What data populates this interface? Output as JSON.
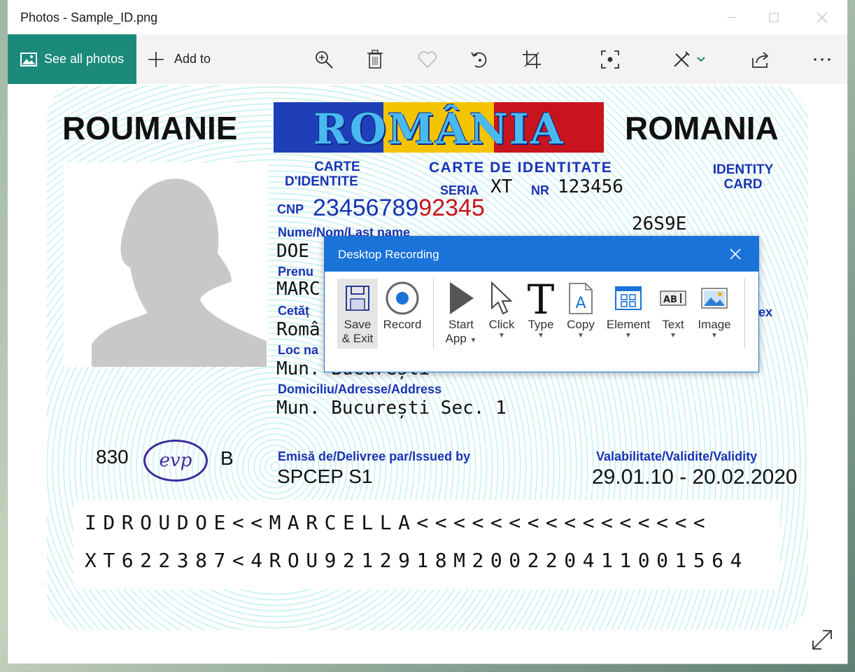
{
  "window": {
    "title": "Photos - Sample_ID.png"
  },
  "toolbar": {
    "see_all": "See all photos",
    "add_to": "Add to"
  },
  "toolbar_icons": [
    "zoom-in-icon",
    "delete-icon",
    "favorite-icon",
    "rotate-icon",
    "crop-icon",
    "visual-search-icon",
    "edit-icon",
    "share-icon",
    "more-icon"
  ],
  "card": {
    "left_title": "ROUMANIE",
    "banner": "ROMÂNIA",
    "right_title": "ROMANIA",
    "carte_fr_1": "CARTE",
    "carte_fr_2": "D'IDENTITE",
    "carte_ro": "CARTE DE IDENTITATE",
    "identity_1": "IDENTITY",
    "identity_2": "CARD",
    "seria_label": "SERIA",
    "seria": "XT",
    "nr_label": "NR",
    "nr": "123456",
    "cnp_label": "CNP",
    "cnp_part1": "23456789",
    "cnp_part2": "92345",
    "code": "26S9E",
    "name_label": "Nume/Nom/Last name",
    "name": "DOE",
    "first_label": "Prenu",
    "first": "MARC",
    "citizenship_label": "Cetăț",
    "citizenship": "Româ",
    "birth_label": "Loc na",
    "birth_place": "Mun. București",
    "sex_label": "ex",
    "address_label": "Domiciliu/Adresse/Address",
    "address": "Mun. București Sec. 1",
    "num830": "830",
    "logo": "evp",
    "letter_b": "B",
    "issued_label": "Emisă de/Delivree par/Issued by",
    "issued": "SPCEP S1",
    "validity_label": "Valabilitate/Validite/Validity",
    "validity": "29.01.10 - 20.02.2020",
    "mrz1": "IDROUDOE<<MARCELLA<<<<<<<<<<<<<<<<",
    "mrz2": "XT622387<4ROU9212918M200220411001564"
  },
  "dialog": {
    "title": "Desktop Recording",
    "buttons": {
      "save_1": "Save",
      "save_2": "& Exit",
      "record": "Record",
      "start_1": "Start",
      "start_2": "App",
      "click": "Click",
      "type": "Type",
      "copy": "Copy",
      "element": "Element",
      "text": "Text",
      "image": "Image"
    }
  },
  "colors": {
    "accent": "#1b8a7a",
    "dialog_header": "#1a73d9",
    "card_blue": "#1933b3",
    "cnp_red": "#c8141c"
  }
}
